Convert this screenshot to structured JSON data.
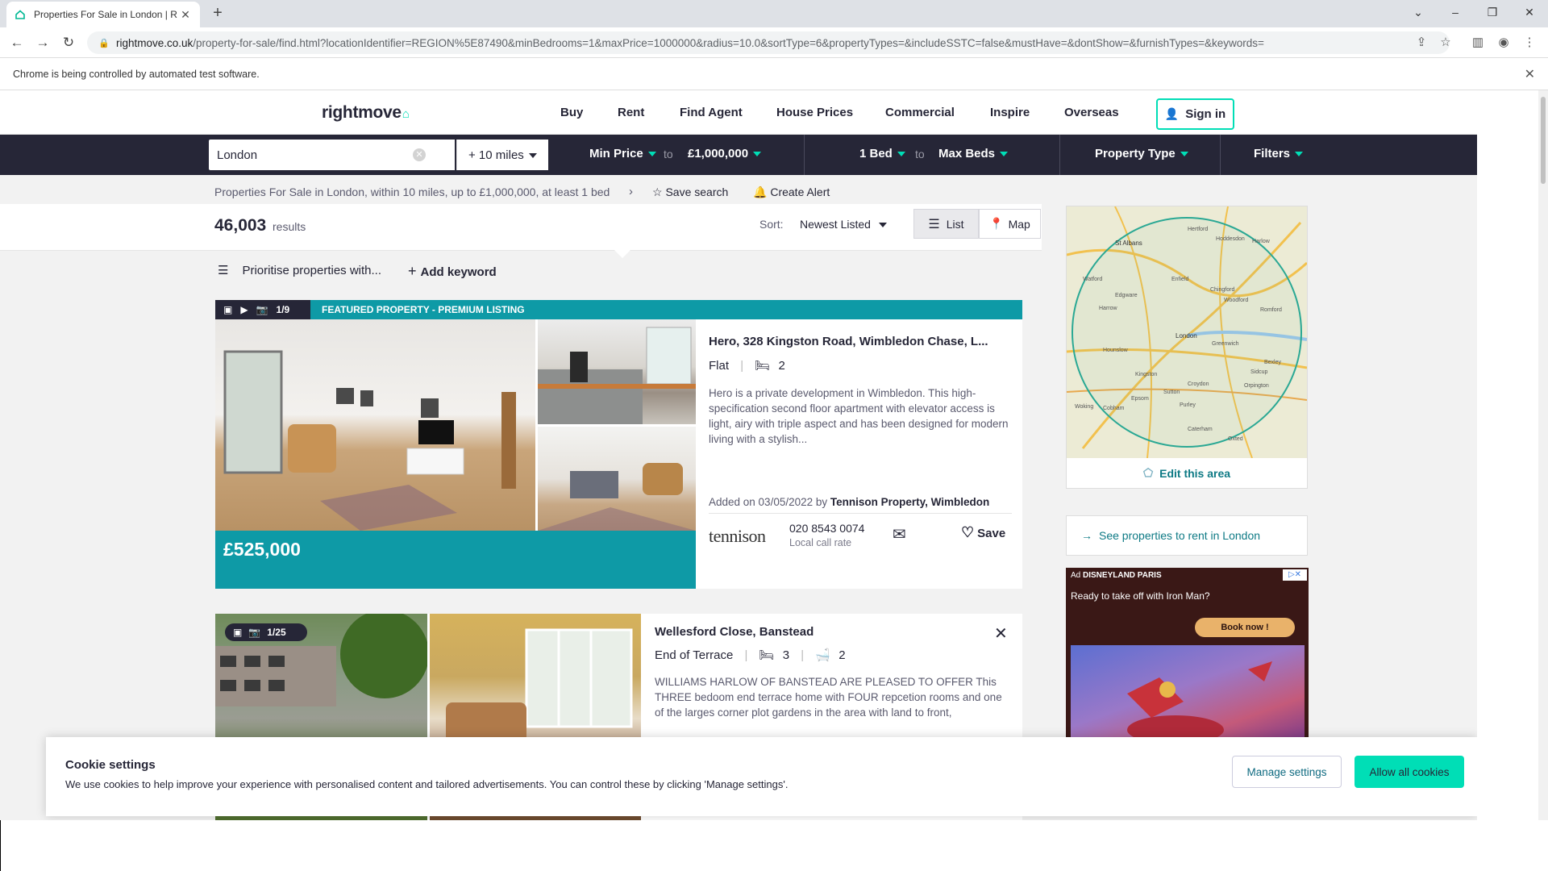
{
  "browser": {
    "tab_title": "Properties For Sale in London | R",
    "url_domain": "rightmove.co.uk",
    "url_path": "/property-for-sale/find.html?locationIdentifier=REGION%5E87490&minBedrooms=1&maxPrice=1000000&radius=10.0&sortType=6&propertyTypes=&includeSSTC=false&mustHave=&dontShow=&furnishTypes=&keywords=",
    "automation_notice": "Chrome is being controlled by automated test software."
  },
  "header": {
    "logo": "rightmove",
    "nav": [
      "Buy",
      "Rent",
      "Find Agent",
      "House Prices",
      "Commercial",
      "Inspire",
      "Overseas"
    ],
    "sign_in": "Sign in"
  },
  "search": {
    "location": "London",
    "radius": "+ 10 miles",
    "min_price": "Min Price",
    "to1": "to",
    "max_price": "£1,000,000",
    "min_beds": "1 Bed",
    "to2": "to",
    "max_beds": "Max Beds",
    "property_type": "Property Type",
    "filters": "Filters"
  },
  "breadcrumb": "Properties For Sale in London, within 10 miles, up to £1,000,000, at least 1 bed",
  "save_search": "Save search",
  "create_alert": "Create Alert",
  "results": {
    "count": "46,003",
    "label": "results",
    "sort_label": "Sort:",
    "sort_value": "Newest Listed",
    "list_btn": "List",
    "map_btn": "Map"
  },
  "prioritise": {
    "text": "Prioritise properties with...",
    "add_keyword": "Add keyword"
  },
  "listings": [
    {
      "photo_count": "1/9",
      "featured": "FEATURED PROPERTY - PREMIUM LISTING",
      "price": "£525,000",
      "title": "Hero, 328 Kingston Road, Wimbledon Chase, L...",
      "type": "Flat",
      "beds": "2",
      "description": "Hero is a private development in Wimbledon. This high-specification second floor apartment with elevator access is light, airy with triple aspect and has been designed for modern living with a stylish...",
      "added": "Added on 03/05/2022 by",
      "agent": "Tennison Property, Wimbledon",
      "agent_logo": "tennison",
      "phone": "020 8543 0074",
      "call_rate": "Local call rate",
      "save": "Save"
    },
    {
      "photo_count": "1/25",
      "title": "Wellesford Close, Banstead",
      "type": "End of Terrace",
      "beds": "3",
      "baths": "2",
      "description": "WILLIAMS HARLOW OF BANSTEAD ARE PLEASED TO OFFER This THREE bedoom end terrace home with FOUR repcetion rooms and one of the larges corner plot gardens in the area with land to front,"
    }
  ],
  "sidebar": {
    "edit_area": "Edit this area",
    "map_labels": [
      "St Albans",
      "Hertford",
      "Hoddesdon",
      "Harlow",
      "Watford",
      "Enfield",
      "Edgware",
      "Harrow",
      "Chingford",
      "Woodford",
      "Romford",
      "London",
      "Greenwich",
      "Hounslow",
      "Bexley",
      "Sidcup",
      "Kingston",
      "Croydon",
      "Orpington",
      "Epsom",
      "Sutton",
      "Purley",
      "Caterham",
      "Woking",
      "Cobham",
      "Oxted"
    ],
    "rent_link": "See properties to rent in London",
    "ad": {
      "tag": "Ad",
      "brand": "DISNEYLAND PARIS",
      "headline": "Ready to take off with Iron Man?",
      "cta": "Book now !"
    }
  },
  "cookie": {
    "title": "Cookie settings",
    "text": "We use cookies to help improve your experience with personalised content and tailored advertisements. You can control these by clicking 'Manage settings'.",
    "manage": "Manage settings",
    "allow": "Allow all cookies"
  },
  "colors": {
    "brand_teal": "#00deb6",
    "featured_teal": "#0e9aa6",
    "navy": "#262637"
  }
}
